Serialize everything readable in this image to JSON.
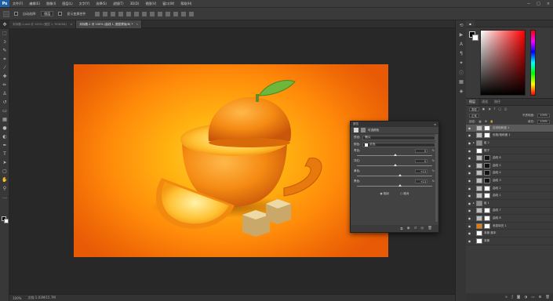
{
  "app": {
    "logo": "Ps",
    "menu": [
      "文件(F)",
      "编辑(E)",
      "图像(I)",
      "图层(L)",
      "文字(Y)",
      "选择(S)",
      "滤镜(T)",
      "3D(D)",
      "视图(V)",
      "窗口(W)",
      "帮助(H)"
    ],
    "window_controls": [
      "−",
      "□",
      "×"
    ]
  },
  "options_bar": {
    "auto_select_label": "自动选择:",
    "auto_select_value": "图层",
    "show_transform_label": "显示变换控件"
  },
  "tools": [
    {
      "name": "move-tool-icon",
      "glyph": "✥"
    },
    {
      "name": "marquee-tool-icon",
      "glyph": "⬚"
    },
    {
      "name": "lasso-tool-icon",
      "glyph": "ↄ"
    },
    {
      "name": "quick-select-tool-icon",
      "glyph": "✎"
    },
    {
      "name": "crop-tool-icon",
      "glyph": "⌗"
    },
    {
      "name": "eyedropper-tool-icon",
      "glyph": "⁄"
    },
    {
      "name": "healing-tool-icon",
      "glyph": "✚"
    },
    {
      "name": "brush-tool-icon",
      "glyph": "✏"
    },
    {
      "name": "clone-stamp-tool-icon",
      "glyph": "♙"
    },
    {
      "name": "history-brush-tool-icon",
      "glyph": "↺"
    },
    {
      "name": "eraser-tool-icon",
      "glyph": "▭"
    },
    {
      "name": "gradient-tool-icon",
      "glyph": "▦"
    },
    {
      "name": "blur-tool-icon",
      "glyph": "●"
    },
    {
      "name": "dodge-tool-icon",
      "glyph": "◐"
    },
    {
      "name": "pen-tool-icon",
      "glyph": "✒"
    },
    {
      "name": "type-tool-icon",
      "glyph": "T"
    },
    {
      "name": "path-select-tool-icon",
      "glyph": "➤"
    },
    {
      "name": "shape-tool-icon",
      "glyph": "▢"
    },
    {
      "name": "hand-tool-icon",
      "glyph": "✋"
    },
    {
      "name": "zoom-tool-icon",
      "glyph": "⚲"
    },
    {
      "name": "more-tools-icon",
      "glyph": "…"
    }
  ],
  "document_tabs": [
    {
      "label": "未标题-1.psd @ 100% (图层 1, RGB/8#)",
      "active": false
    },
    {
      "label": "未标题-1 @ 100% (曲线 1, 图层蒙版/8) *",
      "active": true
    }
  ],
  "status": {
    "zoom": "100%",
    "doc_info": "文档:1.03M/15.7M"
  },
  "layers_panel": {
    "tabs": [
      "图层",
      "通道",
      "路径"
    ],
    "kind_label": "类型",
    "blend_mode": "正常",
    "opacity_label": "不透明度:",
    "opacity_value": "100%",
    "lock_label": "锁定:",
    "fill_label": "填充:",
    "fill_value": "100%",
    "layers": [
      {
        "name": "自然饱和度 1",
        "type": "adj",
        "selected": true,
        "visible": true,
        "mask": "white"
      },
      {
        "name": "色相/饱和度 1",
        "type": "adj",
        "selected": false,
        "visible": true,
        "mask": "white"
      },
      {
        "name": "组 2",
        "type": "group",
        "selected": false,
        "visible": true,
        "mask": "none"
      },
      {
        "name": "橙子",
        "type": "pixel",
        "selected": false,
        "visible": true,
        "mask": "none"
      },
      {
        "name": "曲线 6",
        "type": "adj",
        "selected": false,
        "visible": true,
        "mask": "black"
      },
      {
        "name": "曲线 5",
        "type": "adj",
        "selected": false,
        "visible": true,
        "mask": "black"
      },
      {
        "name": "曲线 4",
        "type": "adj",
        "selected": false,
        "visible": true,
        "mask": "black"
      },
      {
        "name": "曲线 3",
        "type": "adj",
        "selected": false,
        "visible": true,
        "mask": "black"
      },
      {
        "name": "曲线 2",
        "type": "adj",
        "selected": false,
        "visible": true,
        "mask": "white"
      },
      {
        "name": "曲线 1",
        "type": "adj",
        "selected": false,
        "visible": true,
        "mask": "white"
      },
      {
        "name": "组 1",
        "type": "group",
        "selected": false,
        "visible": true,
        "mask": "none"
      },
      {
        "name": "曲线 7",
        "type": "adj",
        "selected": false,
        "visible": true,
        "mask": "white"
      },
      {
        "name": "曲线 8",
        "type": "adj",
        "selected": false,
        "visible": true,
        "mask": "white"
      },
      {
        "name": "渐变填充 1",
        "type": "fill",
        "selected": false,
        "visible": true,
        "mask": "white"
      },
      {
        "name": "背景 副本",
        "type": "pixel",
        "selected": false,
        "visible": true,
        "mask": "none"
      },
      {
        "name": "背景",
        "type": "pixel",
        "selected": false,
        "visible": true,
        "mask": "none"
      }
    ],
    "footer_icons": [
      "link-icon",
      "fx-icon",
      "mask-icon",
      "adjust-icon",
      "folder-icon",
      "new-layer-icon",
      "trash-icon"
    ]
  },
  "properties_panel": {
    "title": "属性",
    "subtitle": "可选颜色",
    "preset_label": "预设:",
    "preset_value": "默认",
    "colors_label": "颜色:",
    "colors_value": "红色",
    "sliders": [
      {
        "label": "青色:",
        "value": "0",
        "pos": 0.5
      },
      {
        "label": "洋红:",
        "value": "0",
        "pos": 0.5
      },
      {
        "label": "黄色:",
        "value": "+13",
        "pos": 0.57
      },
      {
        "label": "黑色:",
        "value": "+13",
        "pos": 0.57
      }
    ],
    "pct": "%",
    "relative_label": "相对",
    "absolute_label": "绝对",
    "footer_icons": [
      "clip-icon",
      "view-prev-icon",
      "reset-icon",
      "visibility-icon",
      "trash-icon"
    ]
  },
  "colors": {
    "accent_orange": "#ff8a0a",
    "panel_bg": "#3b3b3b",
    "selected_layer": "#5a5a5a"
  }
}
